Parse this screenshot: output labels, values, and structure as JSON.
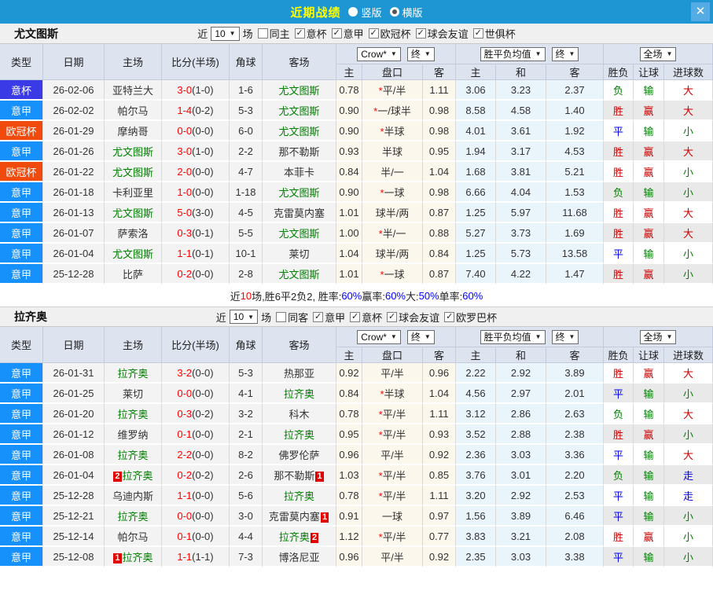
{
  "topbar": {
    "title": "近期战绩",
    "radio_vertical": "竖版",
    "radio_horizontal": "横版",
    "bar_color": "#1e96d3",
    "title_color": "#ffff00"
  },
  "icons": {
    "check": "✓",
    "arrow_down": "▼",
    "close": "✕"
  },
  "columns": {
    "type": "类型",
    "date": "日期",
    "home": "主场",
    "score": "比分(半场)",
    "corner": "角球",
    "away": "客场",
    "h": "主",
    "handicap": "盘口",
    "a": "客",
    "avg_h": "主",
    "avg_d": "和",
    "avg_a": "客",
    "result": "胜负",
    "let_goal": "让球",
    "goals": "进球数"
  },
  "sections": [
    {
      "team": "尤文图斯",
      "filter": {
        "near_label": "近",
        "count": "10",
        "games_label": "场",
        "same_label": "同主",
        "same_checked": false,
        "comps": [
          "意杯",
          "意甲",
          "欧冠杯",
          "球会友谊",
          "世俱杯"
        ]
      },
      "dropdowns": {
        "odds_company": "Crow*",
        "odds_state": "终",
        "avg": "胜平负均值",
        "avg_state": "终",
        "scope": "全场"
      },
      "rows": [
        {
          "type": "意杯",
          "tc": "#3a3ae6",
          "date": "26-02-06",
          "home": "亚特兰大",
          "hg": false,
          "hr": "",
          "score": "3-0",
          "half": "(1-0)",
          "corner": "1-6",
          "away": "尤文图斯",
          "ag": true,
          "ar": "",
          "h": "0.78",
          "pan": "*平/半",
          "a": "1.11",
          "m1": "3.06",
          "m2": "3.23",
          "m3": "2.37",
          "sf": "负",
          "sfc": "green",
          "rq": "输",
          "rqc": "green",
          "jq": "大",
          "jqc": "red"
        },
        {
          "type": "意甲",
          "tc": "#1690fa",
          "date": "26-02-02",
          "home": "帕尔马",
          "hg": false,
          "hr": "",
          "score": "1-4",
          "half": "(0-2)",
          "corner": "5-3",
          "away": "尤文图斯",
          "ag": true,
          "ar": "",
          "h": "0.90",
          "pan": "*一/球半",
          "a": "0.98",
          "m1": "8.58",
          "m2": "4.58",
          "m3": "1.40",
          "sf": "胜",
          "sfc": "red",
          "rq": "赢",
          "rqc": "red",
          "jq": "大",
          "jqc": "red"
        },
        {
          "type": "欧冠杯",
          "tc": "#f04a0c",
          "date": "26-01-29",
          "home": "摩纳哥",
          "hg": false,
          "hr": "",
          "score": "0-0",
          "half": "(0-0)",
          "corner": "6-0",
          "away": "尤文图斯",
          "ag": true,
          "ar": "",
          "h": "0.90",
          "pan": "*半球",
          "a": "0.98",
          "m1": "4.01",
          "m2": "3.61",
          "m3": "1.92",
          "sf": "平",
          "sfc": "blue",
          "rq": "输",
          "rqc": "green",
          "jq": "小",
          "jqc": "green"
        },
        {
          "type": "意甲",
          "tc": "#1690fa",
          "date": "26-01-26",
          "home": "尤文图斯",
          "hg": true,
          "hr": "",
          "score": "3-0",
          "half": "(1-0)",
          "corner": "2-2",
          "away": "那不勒斯",
          "ag": false,
          "ar": "",
          "h": "0.93",
          "pan": "半球",
          "a": "0.95",
          "m1": "1.94",
          "m2": "3.17",
          "m3": "4.53",
          "sf": "胜",
          "sfc": "red",
          "rq": "赢",
          "rqc": "red",
          "jq": "大",
          "jqc": "red"
        },
        {
          "type": "欧冠杯",
          "tc": "#f04a0c",
          "date": "26-01-22",
          "home": "尤文图斯",
          "hg": true,
          "hr": "",
          "score": "2-0",
          "half": "(0-0)",
          "corner": "4-7",
          "away": "本菲卡",
          "ag": false,
          "ar": "",
          "h": "0.84",
          "pan": "半/一",
          "a": "1.04",
          "m1": "1.68",
          "m2": "3.81",
          "m3": "5.21",
          "sf": "胜",
          "sfc": "red",
          "rq": "赢",
          "rqc": "red",
          "jq": "小",
          "jqc": "green"
        },
        {
          "type": "意甲",
          "tc": "#1690fa",
          "date": "26-01-18",
          "home": "卡利亚里",
          "hg": false,
          "hr": "",
          "score": "1-0",
          "half": "(0-0)",
          "corner": "1-18",
          "away": "尤文图斯",
          "ag": true,
          "ar": "",
          "h": "0.90",
          "pan": "*一球",
          "a": "0.98",
          "m1": "6.66",
          "m2": "4.04",
          "m3": "1.53",
          "sf": "负",
          "sfc": "green",
          "rq": "输",
          "rqc": "green",
          "jq": "小",
          "jqc": "green"
        },
        {
          "type": "意甲",
          "tc": "#1690fa",
          "date": "26-01-13",
          "home": "尤文图斯",
          "hg": true,
          "hr": "",
          "score": "5-0",
          "half": "(3-0)",
          "corner": "4-5",
          "away": "克雷莫内塞",
          "ag": false,
          "ar": "",
          "h": "1.01",
          "pan": "球半/两",
          "a": "0.87",
          "m1": "1.25",
          "m2": "5.97",
          "m3": "11.68",
          "sf": "胜",
          "sfc": "red",
          "rq": "赢",
          "rqc": "red",
          "jq": "大",
          "jqc": "red"
        },
        {
          "type": "意甲",
          "tc": "#1690fa",
          "date": "26-01-07",
          "home": "萨索洛",
          "hg": false,
          "hr": "",
          "score": "0-3",
          "half": "(0-1)",
          "corner": "5-5",
          "away": "尤文图斯",
          "ag": true,
          "ar": "",
          "h": "1.00",
          "pan": "*半/一",
          "a": "0.88",
          "m1": "5.27",
          "m2": "3.73",
          "m3": "1.69",
          "sf": "胜",
          "sfc": "red",
          "rq": "赢",
          "rqc": "red",
          "jq": "大",
          "jqc": "red"
        },
        {
          "type": "意甲",
          "tc": "#1690fa",
          "date": "26-01-04",
          "home": "尤文图斯",
          "hg": true,
          "hr": "",
          "score": "1-1",
          "half": "(0-1)",
          "corner": "10-1",
          "away": "莱切",
          "ag": false,
          "ar": "",
          "h": "1.04",
          "pan": "球半/两",
          "a": "0.84",
          "m1": "1.25",
          "m2": "5.73",
          "m3": "13.58",
          "sf": "平",
          "sfc": "blue",
          "rq": "输",
          "rqc": "green",
          "jq": "小",
          "jqc": "green"
        },
        {
          "type": "意甲",
          "tc": "#1690fa",
          "date": "25-12-28",
          "home": "比萨",
          "hg": false,
          "hr": "",
          "score": "0-2",
          "half": "(0-0)",
          "corner": "2-8",
          "away": "尤文图斯",
          "ag": true,
          "ar": "",
          "h": "1.01",
          "pan": "*一球",
          "a": "0.87",
          "m1": "7.40",
          "m2": "4.22",
          "m3": "1.47",
          "sf": "胜",
          "sfc": "red",
          "rq": "赢",
          "rqc": "red",
          "jq": "小",
          "jqc": "green"
        }
      ],
      "summary": [
        {
          "t": "近",
          "c": "black"
        },
        {
          "t": "10",
          "c": "red"
        },
        {
          "t": "场,胜6平2负2, 胜率:",
          "c": "black"
        },
        {
          "t": "60%",
          "c": "blue"
        },
        {
          "t": " 赢率:",
          "c": "black"
        },
        {
          "t": "60%",
          "c": "blue"
        },
        {
          "t": " 大:",
          "c": "black"
        },
        {
          "t": "50%",
          "c": "blue"
        },
        {
          "t": " 单率:",
          "c": "black"
        },
        {
          "t": "60%",
          "c": "blue"
        }
      ]
    },
    {
      "team": "拉齐奥",
      "filter": {
        "near_label": "近",
        "count": "10",
        "games_label": "场",
        "same_label": "同客",
        "same_checked": false,
        "comps": [
          "意甲",
          "意杯",
          "球会友谊",
          "欧罗巴杯"
        ]
      },
      "dropdowns": {
        "odds_company": "Crow*",
        "odds_state": "终",
        "avg": "胜平负均值",
        "avg_state": "终",
        "scope": "全场"
      },
      "rows": [
        {
          "type": "意甲",
          "tc": "#1690fa",
          "date": "26-01-31",
          "home": "拉齐奥",
          "hg": true,
          "hr": "",
          "score": "3-2",
          "half": "(0-0)",
          "corner": "5-3",
          "away": "热那亚",
          "ag": false,
          "ar": "",
          "h": "0.92",
          "pan": "平/半",
          "a": "0.96",
          "m1": "2.22",
          "m2": "2.92",
          "m3": "3.89",
          "sf": "胜",
          "sfc": "red",
          "rq": "赢",
          "rqc": "red",
          "jq": "大",
          "jqc": "red"
        },
        {
          "type": "意甲",
          "tc": "#1690fa",
          "date": "26-01-25",
          "home": "莱切",
          "hg": false,
          "hr": "",
          "score": "0-0",
          "half": "(0-0)",
          "corner": "4-1",
          "away": "拉齐奥",
          "ag": true,
          "ar": "",
          "h": "0.84",
          "pan": "*半球",
          "a": "1.04",
          "m1": "4.56",
          "m2": "2.97",
          "m3": "2.01",
          "sf": "平",
          "sfc": "blue",
          "rq": "输",
          "rqc": "green",
          "jq": "小",
          "jqc": "green"
        },
        {
          "type": "意甲",
          "tc": "#1690fa",
          "date": "26-01-20",
          "home": "拉齐奥",
          "hg": true,
          "hr": "",
          "score": "0-3",
          "half": "(0-2)",
          "corner": "3-2",
          "away": "科木",
          "ag": false,
          "ar": "",
          "h": "0.78",
          "pan": "*平/半",
          "a": "1.11",
          "m1": "3.12",
          "m2": "2.86",
          "m3": "2.63",
          "sf": "负",
          "sfc": "green",
          "rq": "输",
          "rqc": "green",
          "jq": "大",
          "jqc": "red"
        },
        {
          "type": "意甲",
          "tc": "#1690fa",
          "date": "26-01-12",
          "home": "维罗纳",
          "hg": false,
          "hr": "",
          "score": "0-1",
          "half": "(0-0)",
          "corner": "2-1",
          "away": "拉齐奥",
          "ag": true,
          "ar": "",
          "h": "0.95",
          "pan": "*平/半",
          "a": "0.93",
          "m1": "3.52",
          "m2": "2.88",
          "m3": "2.38",
          "sf": "胜",
          "sfc": "red",
          "rq": "赢",
          "rqc": "red",
          "jq": "小",
          "jqc": "green"
        },
        {
          "type": "意甲",
          "tc": "#1690fa",
          "date": "26-01-08",
          "home": "拉齐奥",
          "hg": true,
          "hr": "",
          "score": "2-2",
          "half": "(0-0)",
          "corner": "8-2",
          "away": "佛罗伦萨",
          "ag": false,
          "ar": "",
          "h": "0.96",
          "pan": "平/半",
          "a": "0.92",
          "m1": "2.36",
          "m2": "3.03",
          "m3": "3.36",
          "sf": "平",
          "sfc": "blue",
          "rq": "输",
          "rqc": "green",
          "jq": "大",
          "jqc": "red"
        },
        {
          "type": "意甲",
          "tc": "#1690fa",
          "date": "26-01-04",
          "home": "拉齐奥",
          "hg": true,
          "hr": "2",
          "score": "0-2",
          "half": "(0-2)",
          "corner": "2-6",
          "away": "那不勒斯",
          "ag": false,
          "ar": "1",
          "h": "1.03",
          "pan": "*平/半",
          "a": "0.85",
          "m1": "3.76",
          "m2": "3.01",
          "m3": "2.20",
          "sf": "负",
          "sfc": "green",
          "rq": "输",
          "rqc": "green",
          "jq": "走",
          "jqc": "blue"
        },
        {
          "type": "意甲",
          "tc": "#1690fa",
          "date": "25-12-28",
          "home": "乌迪内斯",
          "hg": false,
          "hr": "",
          "score": "1-1",
          "half": "(0-0)",
          "corner": "5-6",
          "away": "拉齐奥",
          "ag": true,
          "ar": "",
          "h": "0.78",
          "pan": "*平/半",
          "a": "1.11",
          "m1": "3.20",
          "m2": "2.92",
          "m3": "2.53",
          "sf": "平",
          "sfc": "blue",
          "rq": "输",
          "rqc": "green",
          "jq": "走",
          "jqc": "blue"
        },
        {
          "type": "意甲",
          "tc": "#1690fa",
          "date": "25-12-21",
          "home": "拉齐奥",
          "hg": true,
          "hr": "",
          "score": "0-0",
          "half": "(0-0)",
          "corner": "3-0",
          "away": "克雷莫内塞",
          "ag": false,
          "ar": "1",
          "h": "0.91",
          "pan": "一球",
          "a": "0.97",
          "m1": "1.56",
          "m2": "3.89",
          "m3": "6.46",
          "sf": "平",
          "sfc": "blue",
          "rq": "输",
          "rqc": "green",
          "jq": "小",
          "jqc": "green"
        },
        {
          "type": "意甲",
          "tc": "#1690fa",
          "date": "25-12-14",
          "home": "帕尔马",
          "hg": false,
          "hr": "",
          "score": "0-1",
          "half": "(0-0)",
          "corner": "4-4",
          "away": "拉齐奥",
          "ag": true,
          "ar": "2",
          "h": "1.12",
          "pan": "*平/半",
          "a": "0.77",
          "m1": "3.83",
          "m2": "3.21",
          "m3": "2.08",
          "sf": "胜",
          "sfc": "red",
          "rq": "赢",
          "rqc": "red",
          "jq": "小",
          "jqc": "green"
        },
        {
          "type": "意甲",
          "tc": "#1690fa",
          "date": "25-12-08",
          "home": "拉齐奥",
          "hg": true,
          "hr": "1",
          "score": "1-1",
          "half": "(1-1)",
          "corner": "7-3",
          "away": "博洛尼亚",
          "ag": false,
          "ar": "",
          "h": "0.96",
          "pan": "平/半",
          "a": "0.92",
          "m1": "2.35",
          "m2": "3.03",
          "m3": "3.38",
          "sf": "平",
          "sfc": "blue",
          "rq": "输",
          "rqc": "green",
          "jq": "小",
          "jqc": "green"
        }
      ],
      "summary": []
    }
  ]
}
